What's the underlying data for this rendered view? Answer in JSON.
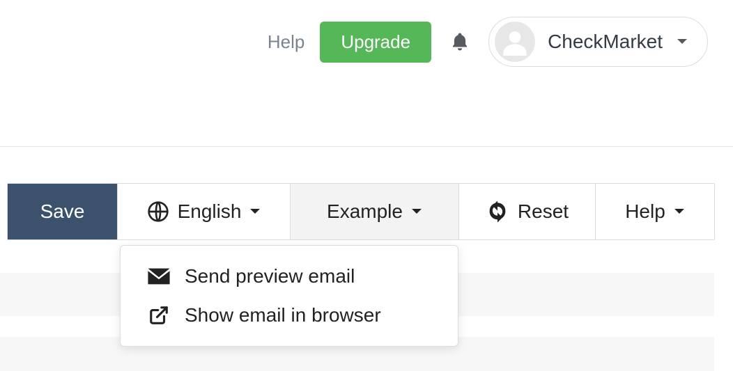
{
  "header": {
    "help_label": "Help",
    "upgrade_label": "Upgrade",
    "account_name": "CheckMarket"
  },
  "toolbar": {
    "save_label": "Save",
    "language_label": "English",
    "example_label": "Example",
    "reset_label": "Reset",
    "help_label": "Help"
  },
  "example_menu": {
    "items": [
      {
        "label": "Send preview email"
      },
      {
        "label": "Show email in browser"
      }
    ]
  }
}
